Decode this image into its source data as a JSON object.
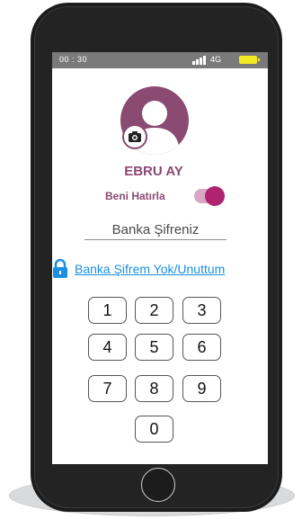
{
  "status_bar": {
    "time": "00 : 30",
    "network": "4G",
    "battery_color": "#f4ea22"
  },
  "profile": {
    "name": "EBRU AY",
    "avatar_color": "#8a4a72",
    "camera_icon": "camera-icon"
  },
  "remember_me": {
    "label": "Beni Hatırla",
    "enabled": true,
    "accent": "#b0246f"
  },
  "password": {
    "placeholder": "Banka Şifreniz"
  },
  "forgot": {
    "icon": "lock-icon",
    "label": "Banka Şifrem Yok/Unuttum",
    "color": "#1a8fe3"
  },
  "keypad": {
    "keys": [
      "1",
      "2",
      "3",
      "4",
      "5",
      "6",
      "7",
      "8",
      "9",
      "0"
    ]
  }
}
